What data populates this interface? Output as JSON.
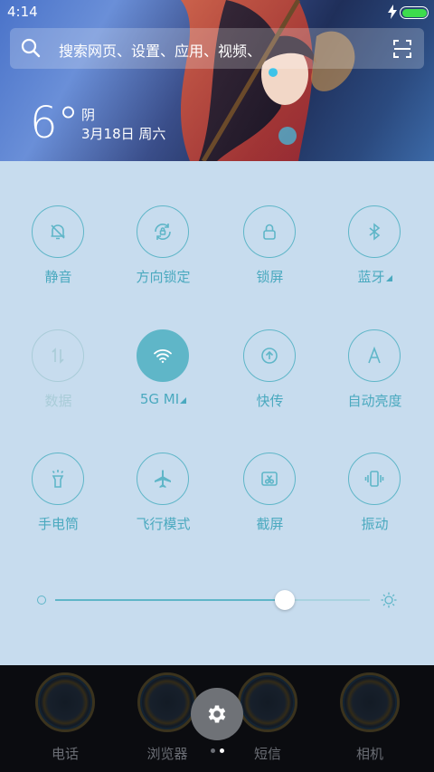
{
  "status_bar": {
    "time": "4:14",
    "battery_level": 1.0,
    "charging": true,
    "battery_color": "#3ddc4d"
  },
  "search": {
    "placeholder": "搜索网页、设置、应用、视频、",
    "icon": "search-icon",
    "scan_icon": "scan-icon"
  },
  "weather": {
    "temperature": "6°",
    "condition": "阴",
    "date": "3月18日 周六"
  },
  "toggles": [
    {
      "label": "静音",
      "icon": "bell-mute-icon",
      "state": "off"
    },
    {
      "label": "方向锁定",
      "icon": "rotation-lock-icon",
      "state": "off"
    },
    {
      "label": "锁屏",
      "icon": "lock-icon",
      "state": "off"
    },
    {
      "label": "蓝牙",
      "icon": "bluetooth-icon",
      "state": "off",
      "has_menu": true
    },
    {
      "label": "数据",
      "icon": "data-icon",
      "state": "disabled"
    },
    {
      "label": "5G MI",
      "icon": "wifi-icon",
      "state": "on",
      "has_menu": true
    },
    {
      "label": "快传",
      "icon": "fast-transfer-icon",
      "state": "off"
    },
    {
      "label": "自动亮度",
      "icon": "auto-brightness-icon",
      "state": "off"
    },
    {
      "label": "手电筒",
      "icon": "flashlight-icon",
      "state": "off"
    },
    {
      "label": "飞行模式",
      "icon": "airplane-icon",
      "state": "off"
    },
    {
      "label": "截屏",
      "icon": "screenshot-icon",
      "state": "off"
    },
    {
      "label": "振动",
      "icon": "vibrate-icon",
      "state": "off"
    }
  ],
  "brightness": {
    "level": 0.73
  },
  "colors": {
    "accent": "#5fb6c8",
    "panel_bg": "#c7dcee",
    "label": "#4aa9bf",
    "disabled": "#a9ccd8"
  },
  "dock": {
    "apps": [
      {
        "label": "电话",
        "icon": "phone-app-icon"
      },
      {
        "label": "浏览器",
        "icon": "browser-app-icon"
      },
      {
        "label": "短信",
        "icon": "messages-app-icon"
      },
      {
        "label": "相机",
        "icon": "camera-app-icon"
      }
    ],
    "settings_icon": "gear-icon",
    "page_count": 2,
    "current_page": 1
  }
}
